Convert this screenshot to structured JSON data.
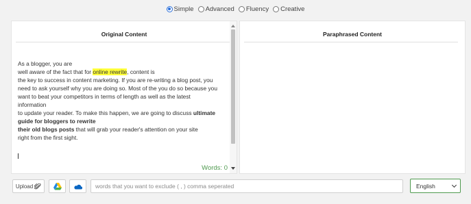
{
  "modes": [
    {
      "label": "Simple",
      "checked": true
    },
    {
      "label": "Advanced",
      "checked": false
    },
    {
      "label": "Fluency",
      "checked": false
    },
    {
      "label": "Creative",
      "checked": false
    }
  ],
  "original": {
    "title": "Original Content",
    "lines": [
      [
        {
          "t": " As a blogger, you are"
        }
      ],
      [
        {
          "t": "well aware of the fact that for "
        },
        {
          "t": "online rewrite",
          "style": "highlight"
        },
        {
          "t": ", content is"
        }
      ],
      [
        {
          "t": "the key to success in content marketing. If you are re-writing a blog post, you"
        }
      ],
      [
        {
          "t": "need to ask yourself why you are doing so. Most of the you do so because you"
        }
      ],
      [
        {
          "t": "want to beat your competitors in terms of length as well as the latest"
        }
      ],
      [
        {
          "t": "information"
        }
      ],
      [
        {
          "t": "to update your reader. To make this happen, we are going to discuss "
        },
        {
          "t": "ultimate",
          "style": "bold"
        }
      ],
      [
        {
          "t": "guide for bloggers to rewrite",
          "style": "bold"
        }
      ],
      [
        {
          "t": "their old blogs posts",
          "style": "bold"
        },
        {
          "t": " that will grab your reader's attention on your site"
        }
      ],
      [
        {
          "t": "right from the first sight."
        }
      ]
    ],
    "word_count": "Words: 0"
  },
  "paraphrased": {
    "title": "Paraphrased Content"
  },
  "toolbar": {
    "upload_label": "Upload",
    "exclude_placeholder": "words that you want to exclude ( , ) comma seperated",
    "language": "English"
  },
  "colors": {
    "accent": "#2a6fdb",
    "highlight": "#ffff3a",
    "word_count": "#4f9a4f",
    "lang_border": "#4f9a4f"
  },
  "icons": {
    "upload": "paperclip-icon",
    "gdrive": "google-drive-icon",
    "onedrive": "onedrive-cloud-icon"
  }
}
